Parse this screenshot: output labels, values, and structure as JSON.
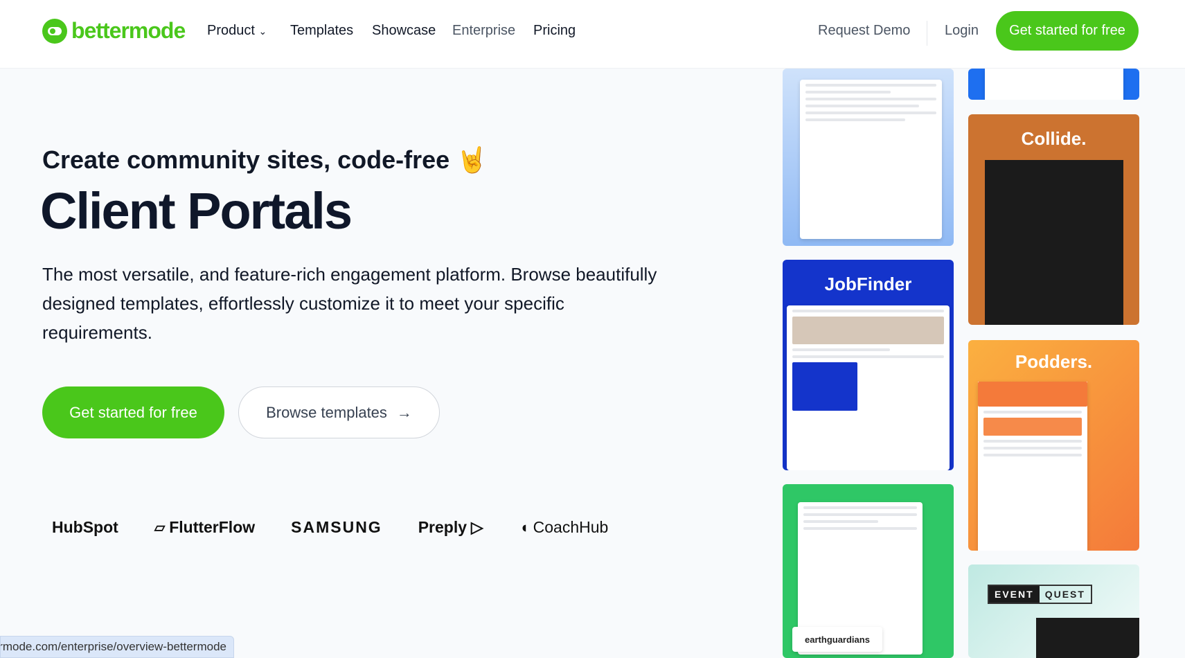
{
  "nav": {
    "logo": "bettermode",
    "items": [
      "Product",
      "Templates",
      "Showcase",
      "Enterprise",
      "Pricing"
    ],
    "request_demo": "Request Demo",
    "login": "Login",
    "cta": "Get started for free"
  },
  "hero": {
    "subtitle": "Create community sites, code-free",
    "emoji": "🤘",
    "title": "Client Portals",
    "paragraph": "The most versatile, and feature-rich engagement platform. Browse beautifully designed templates, effortlessly customize it to meet your specific requirements.",
    "primary_cta": "Get started for free",
    "secondary_cta": "Browse templates"
  },
  "logos": [
    "HubSpot",
    "FlutterFlow",
    "SAMSUNG",
    "Preply",
    "CoachHub"
  ],
  "showcase": {
    "cards": [
      "Collide.",
      "JobFinder",
      "Podders.",
      "earthguardians",
      "EVENT",
      "QUEST"
    ]
  },
  "status_bar": "ermode.com/enterprise/overview-bettermode",
  "colors": {
    "brand": "#4ac71b",
    "jobfinder": "#1434cb",
    "collide": "#cc7330",
    "podders": "#f7923a",
    "earthguardians": "#2fc766"
  }
}
